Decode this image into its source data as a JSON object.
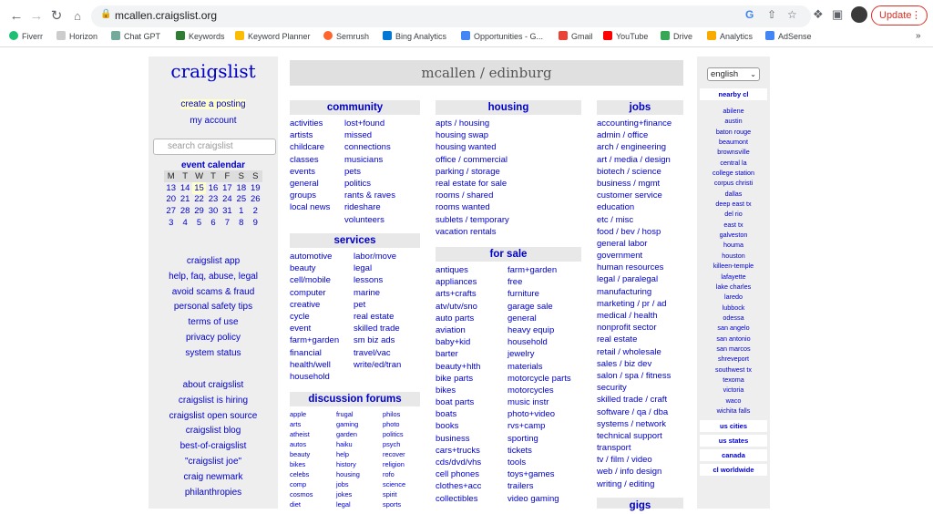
{
  "browser": {
    "url": "mcallen.craigslist.org",
    "update_label": "Update",
    "bookmarks": [
      "Fiverr",
      "Horizon",
      "Chat GPT",
      "Keywords",
      "Keyword Planner",
      "Semrush",
      "Bing Analytics",
      "Opportunities - G...",
      "Gmail",
      "YouTube",
      "Drive",
      "Analytics",
      "AdSense"
    ]
  },
  "left": {
    "logo": "craigslist",
    "create_posting": "create a posting",
    "my_account": "my account",
    "search_placeholder": "search craigslist",
    "event_calendar": "event calendar",
    "cal_head": [
      "M",
      "T",
      "W",
      "T",
      "F",
      "S",
      "S"
    ],
    "cal_weeks": [
      [
        "13",
        "14",
        "15",
        "16",
        "17",
        "18",
        "19"
      ],
      [
        "20",
        "21",
        "22",
        "23",
        "24",
        "25",
        "26"
      ],
      [
        "27",
        "28",
        "29",
        "30",
        "31",
        "1",
        "2"
      ],
      [
        "3",
        "4",
        "5",
        "6",
        "7",
        "8",
        "9"
      ]
    ],
    "links1": [
      "craigslist app",
      "help, faq, abuse, legal",
      "avoid scams & fraud",
      "personal safety tips",
      "terms of use",
      "privacy policy",
      "system status"
    ],
    "links2": [
      "about craigslist",
      "craigslist is hiring",
      "craigslist open source",
      "craigslist blog",
      "best-of-craigslist",
      "\"craigslist joe\"",
      "craig newmark",
      "philanthropies"
    ]
  },
  "main": {
    "location": "mcallen / edinburg",
    "community": {
      "title": "community",
      "left": [
        "activities",
        "artists",
        "childcare",
        "classes",
        "events",
        "general",
        "groups",
        "local news"
      ],
      "right": [
        "lost+found",
        "missed",
        "connections",
        "musicians",
        "pets",
        "politics",
        "rants & raves",
        "rideshare",
        "volunteers"
      ]
    },
    "services": {
      "title": "services",
      "left": [
        "automotive",
        "beauty",
        "cell/mobile",
        "computer",
        "creative",
        "cycle",
        "event",
        "farm+garden",
        "financial",
        "health/well",
        "household"
      ],
      "right": [
        "labor/move",
        "legal",
        "lessons",
        "marine",
        "pet",
        "real estate",
        "skilled trade",
        "sm biz ads",
        "travel/vac",
        "write/ed/tran"
      ]
    },
    "forums": {
      "title": "discussion forums",
      "c1": [
        "apple",
        "arts",
        "atheist",
        "autos",
        "beauty",
        "bikes",
        "celebs",
        "comp",
        "cosmos",
        "diet"
      ],
      "c2": [
        "frugal",
        "gaming",
        "garden",
        "haiku",
        "help",
        "history",
        "housing",
        "jobs",
        "jokes",
        "legal"
      ],
      "c3": [
        "philos",
        "photo",
        "politics",
        "psych",
        "recover",
        "religion",
        "rofo",
        "science",
        "spirit",
        "sports"
      ]
    },
    "housing": {
      "title": "housing",
      "items": [
        "apts / housing",
        "housing swap",
        "housing wanted",
        "office / commercial",
        "parking / storage",
        "real estate for sale",
        "rooms / shared",
        "rooms wanted",
        "sublets / temporary",
        "vacation rentals"
      ]
    },
    "forsale": {
      "title": "for sale",
      "left": [
        "antiques",
        "appliances",
        "arts+crafts",
        "atv/utv/sno",
        "auto parts",
        "aviation",
        "baby+kid",
        "barter",
        "beauty+hlth",
        "bike parts",
        "bikes",
        "boat parts",
        "boats",
        "books",
        "business",
        "cars+trucks",
        "cds/dvd/vhs",
        "cell phones",
        "clothes+acc",
        "collectibles"
      ],
      "right": [
        "farm+garden",
        "free",
        "furniture",
        "garage sale",
        "general",
        "heavy equip",
        "household",
        "jewelry",
        "materials",
        "motorcycle parts",
        "motorcycles",
        "music instr",
        "photo+video",
        "rvs+camp",
        "sporting",
        "tickets",
        "tools",
        "toys+games",
        "trailers",
        "video gaming"
      ]
    },
    "jobs": {
      "title": "jobs",
      "items": [
        "accounting+finance",
        "admin / office",
        "arch / engineering",
        "art / media / design",
        "biotech / science",
        "business / mgmt",
        "customer service",
        "education",
        "etc / misc",
        "food / bev / hosp",
        "general labor",
        "government",
        "human resources",
        "legal / paralegal",
        "manufacturing",
        "marketing / pr / ad",
        "medical / health",
        "nonprofit sector",
        "real estate",
        "retail / wholesale",
        "sales / biz dev",
        "salon / spa / fitness",
        "security",
        "skilled trade / craft",
        "software / qa / dba",
        "systems / network",
        "technical support",
        "transport",
        "tv / film / video",
        "web / info design",
        "writing / editing"
      ]
    },
    "gigs": {
      "title": "gigs"
    }
  },
  "right": {
    "language": "english",
    "nearby_title": "nearby cl",
    "nearby": [
      "abilene",
      "austin",
      "baton rouge",
      "beaumont",
      "brownsville",
      "central la",
      "college station",
      "corpus christi",
      "dallas",
      "deep east tx",
      "del rio",
      "east tx",
      "galveston",
      "houma",
      "houston",
      "killeen-temple",
      "lafayette",
      "lake charles",
      "laredo",
      "lubbock",
      "odessa",
      "san angelo",
      "san antonio",
      "san marcos",
      "shreveport",
      "southwest tx",
      "texoma",
      "victoria",
      "waco",
      "wichita falls"
    ],
    "us_cities": "us cities",
    "us_states": "us states",
    "canada": "canada",
    "worldwide": "cl worldwide"
  }
}
